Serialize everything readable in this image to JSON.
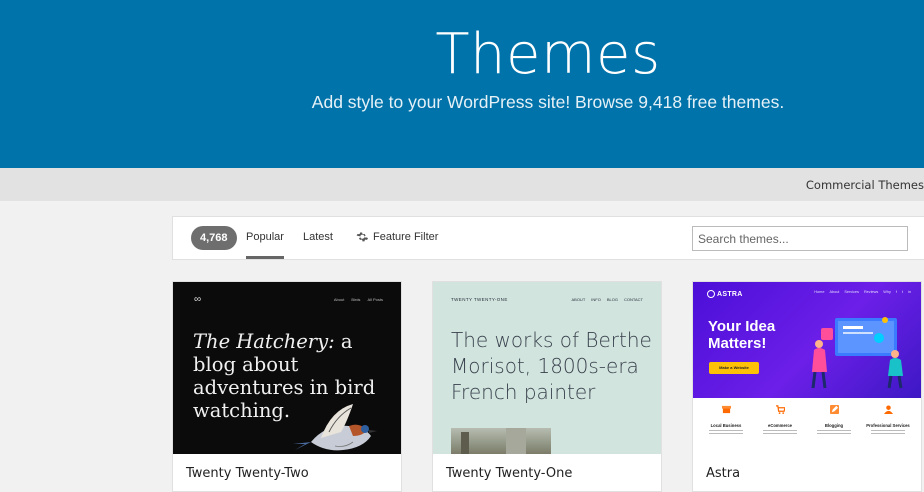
{
  "header": {
    "title": "Themes",
    "subtitle": "Add style to your WordPress site! Browse 9,418 free themes."
  },
  "subnav": {
    "commercial_label": "Commercial Themes"
  },
  "filter_bar": {
    "count": "4,768",
    "tabs": [
      {
        "label": "Popular",
        "active": true
      },
      {
        "label": "Latest",
        "active": false
      },
      {
        "label": "Feature Filter",
        "icon": "gear-icon"
      }
    ],
    "search": {
      "placeholder": "Search themes...",
      "value": ""
    }
  },
  "themes": [
    {
      "name": "Twenty Twenty-Two",
      "preview": {
        "logo": "∞",
        "nav": [
          "About",
          "Birds",
          "All Posts"
        ],
        "headline_italic": "The Hatchery:",
        "headline_rest": " a blog about adventures in bird watching."
      }
    },
    {
      "name": "Twenty Twenty-One",
      "preview": {
        "logo": "TWENTY TWENTY-ONE",
        "nav": [
          "ABOUT",
          "INFO",
          "BLOG",
          "CONTACT"
        ],
        "headline": "The works of Berthe Morisot, 1800s-era French painter"
      }
    },
    {
      "name": "Astra",
      "preview": {
        "brand": "ASTRA",
        "nav": [
          "Home",
          "About",
          "Services",
          "Reviews",
          "Why",
          "f",
          "t",
          "in"
        ],
        "headline": "Your Idea Matters!",
        "cta": "Make a Website",
        "features": [
          {
            "title": "Local Business",
            "icon": "store-icon"
          },
          {
            "title": "eCommerce",
            "icon": "cart-icon"
          },
          {
            "title": "Blogging",
            "icon": "pencil-icon"
          },
          {
            "title": "Professional Services",
            "icon": "person-icon"
          }
        ]
      }
    }
  ],
  "colors": {
    "header_bg": "#0073aa",
    "page_bg": "#f1f1f1",
    "astra_purple": "#5a14e0",
    "astra_yellow": "#ffc107",
    "astra_orange": "#ff6a00",
    "tt1_green": "#d1e4dd"
  }
}
